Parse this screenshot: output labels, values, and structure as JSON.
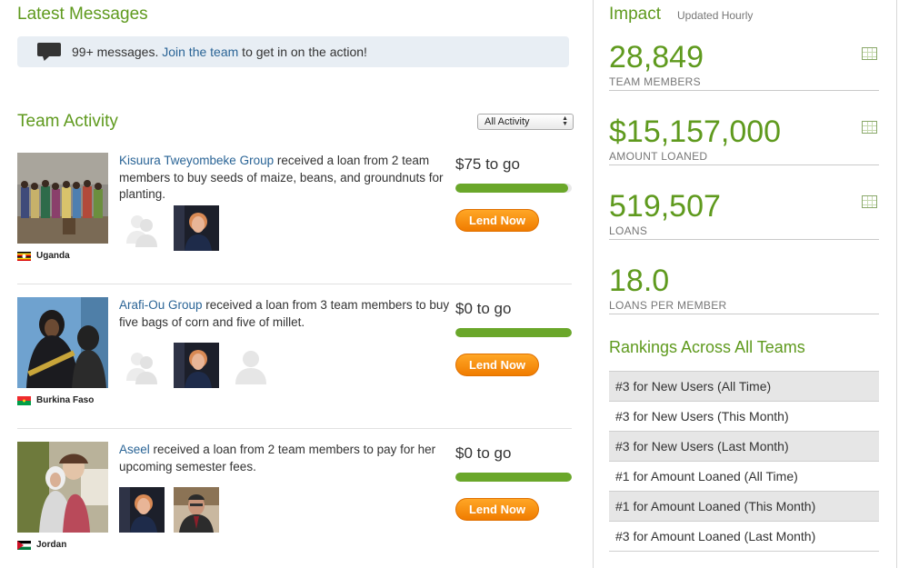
{
  "latest": {
    "title": "Latest Messages",
    "text_before": "99+ messages. ",
    "link": "Join the team",
    "text_after": " to get in on the action!"
  },
  "activity": {
    "title": "Team Activity",
    "filter_value": "All Activity",
    "items": [
      {
        "name": "Kisuura Tweyombeke Group",
        "text": " received a loan from 2 team members to buy seeds of maize, beans, and groundnuts for planting.",
        "country": "Uganda",
        "amount": "$75 to go",
        "progress": 0.97,
        "button": "Lend Now"
      },
      {
        "name": "Arafi-Ou Group",
        "text": " received a loan from 3 team members to buy five bags of corn and five of millet.",
        "country": "Burkina Faso",
        "amount": "$0 to go",
        "progress": 1.0,
        "button": "Lend Now"
      },
      {
        "name": "Aseel",
        "text": " received a loan from 2 team members to pay for her upcoming semester fees.",
        "country": "Jordan",
        "amount": "$0 to go",
        "progress": 1.0,
        "button": "Lend Now"
      }
    ]
  },
  "impact": {
    "title": "Impact",
    "subtitle": "Updated Hourly",
    "stats": [
      {
        "value": "28,849",
        "label": "TEAM MEMBERS"
      },
      {
        "value": "$15,157,000",
        "label": "AMOUNT LOANED"
      },
      {
        "value": "519,507",
        "label": "LOANS"
      },
      {
        "value": "18.0",
        "label": "LOANS PER MEMBER"
      }
    ]
  },
  "rankings": {
    "title": "Rankings Across All Teams",
    "items": [
      "#3 for New Users (All Time)",
      "#3 for New Users (This Month)",
      "#3 for New Users (Last Month)",
      "#1 for Amount Loaned (All Time)",
      "#1 for Amount Loaned (This Month)",
      "#3 for Amount Loaned (Last Month)"
    ]
  },
  "colors": {
    "accent_green": "#5f9a1e",
    "link_blue": "#2a6496",
    "lend_orange": "#f39200",
    "progress_green": "#6aa72a"
  }
}
